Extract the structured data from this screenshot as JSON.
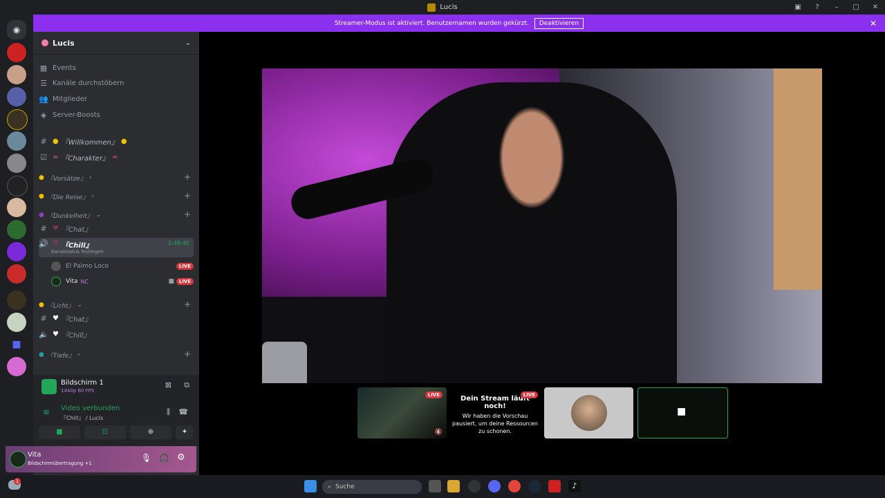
{
  "window": {
    "title": "Lucis"
  },
  "banner": {
    "text": "Streamer-Modus ist aktiviert. Benutzernamen wurden gekürzt.",
    "button": "Deaktivieren"
  },
  "server": {
    "name": "Lucis"
  },
  "nav": [
    {
      "label": "Events",
      "icon": "calendar-icon"
    },
    {
      "label": "Kanäle durchstöbern",
      "icon": "browse-icon"
    },
    {
      "label": "Mitglieder",
      "icon": "members-icon"
    },
    {
      "label": "Server-Boosts",
      "icon": "boost-icon"
    }
  ],
  "channels": {
    "willkommen": "『Willkommen』",
    "charakter": "『Charakter』",
    "cat_vorsaetze": "『Vorsätze』",
    "cat_reise": "『Die Reise』",
    "cat_dunkelheit": "『Dunkelheit』",
    "chat1": "『Chat』",
    "chill1": "『Chill』",
    "chill1_timer": "2:48:40",
    "chill1_status": "Kanalstatus festlegen",
    "user1": "El Palmo Loco",
    "user2": "Vita",
    "user2_tag": "NC",
    "live": "LIVE",
    "cat_licht": "『Licht』",
    "chat2": "『Chat』",
    "chill2": "『Chill』",
    "cat_tiefe": "『Tiefe』"
  },
  "voice": {
    "screen_title": "Bildschirm 1",
    "screen_sub": "1440p 60 FPS",
    "connected": "Video verbunden",
    "location": "『Chill』 / Lucis"
  },
  "user_panel": {
    "name": "Vita",
    "status": "Bildschirmübertragung +1"
  },
  "stream_card": {
    "live": "LIVE",
    "title": "Dein Stream läuft noch!",
    "body": "Wir haben die Vorschau pausiert, um deine Ressourcen zu schonen."
  },
  "taskbar": {
    "search_placeholder": "Suche",
    "notif_count": "1"
  },
  "colors": {
    "accent": "#8c30ef",
    "live": "#da373c",
    "connected": "#23a55a"
  }
}
